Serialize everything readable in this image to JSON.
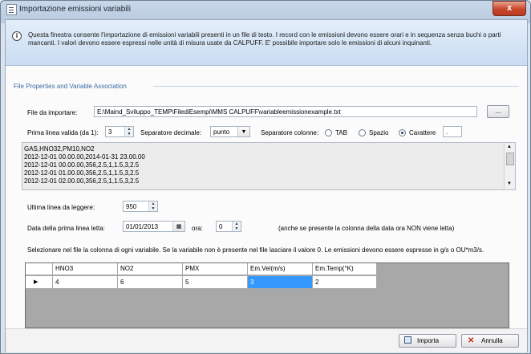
{
  "window": {
    "title": "Importazione emissioni variabili",
    "close_glyph": "x"
  },
  "info": {
    "icon": "info-icon",
    "text": "Questa finestra consente l'importazione di emissioni variabili presenti in un file di testo. I record con le emissioni devono essere orari e in sequenza senza buchi o parti mancanti. I valori devono essere espressi nelle unità di misura usate da CALPUFF. E' possibile importare solo le emissioni di alcuni inquinanti."
  },
  "group": {
    "label": "File Properties and Variable Association"
  },
  "file": {
    "label": "File da importare:",
    "path": "E:\\Maind_Sviluppo_TEMP\\FilediEsempi\\MMS CALPUFF\\variableemissionexample.txt",
    "browse_label": "..."
  },
  "options": {
    "first_line_label": "Prima linea valida (da 1):",
    "first_line_value": "3",
    "decimal_sep_label": "Separatore decimale:",
    "decimal_sep_value": "punto",
    "col_sep_label": "Separatore colonne:",
    "radio_tab": "TAB",
    "radio_space": "Spazio",
    "radio_char": "Carattere",
    "char_value": ".",
    "selected_radio": "Carattere"
  },
  "preview_lines": [
    "GAS,HNO32,PM10,NO2",
    "2012-12-01 00.00.00,2014-01-31 23.00.00",
    "2012-12-01 00.00.00,356,2.5,1,1.5,3,2.5",
    "2012-12-01 01.00.00,356,2.5,1,1.5,3,2.5",
    "2012-12-01 02.00.00,356,2.5,1,1.5,3,2.5"
  ],
  "last_line": {
    "label": "Ultima linea da leggere:",
    "value": "950"
  },
  "date": {
    "label": "Data della prima linea letta:",
    "value": "01/01/2013",
    "hour_label": "ora:",
    "hour_value": "0",
    "note": "(anche se presente la colonna della data ora NON viene letta)"
  },
  "instructions": "Selezionare nel file la colonna di ogni variabile. Se la variabile non è presente nel file lasciare il valore 0. Le emissioni devono essere espresse in g/s o OU*m3/s.",
  "grid": {
    "columns": [
      "HNO3",
      "NO2",
      "PMX",
      "Em.Vel(m/s)",
      "Em.Temp(°K)"
    ],
    "row": [
      "4",
      "6",
      "5",
      "3",
      "2"
    ],
    "selected_col": 3,
    "row_marker": "▶"
  },
  "buttons": {
    "import_label": "Importa",
    "cancel_label": "Annulla"
  },
  "colors": {
    "selection": "#3399ff",
    "group_label": "#3a6ea5",
    "close": "#c9462b"
  }
}
